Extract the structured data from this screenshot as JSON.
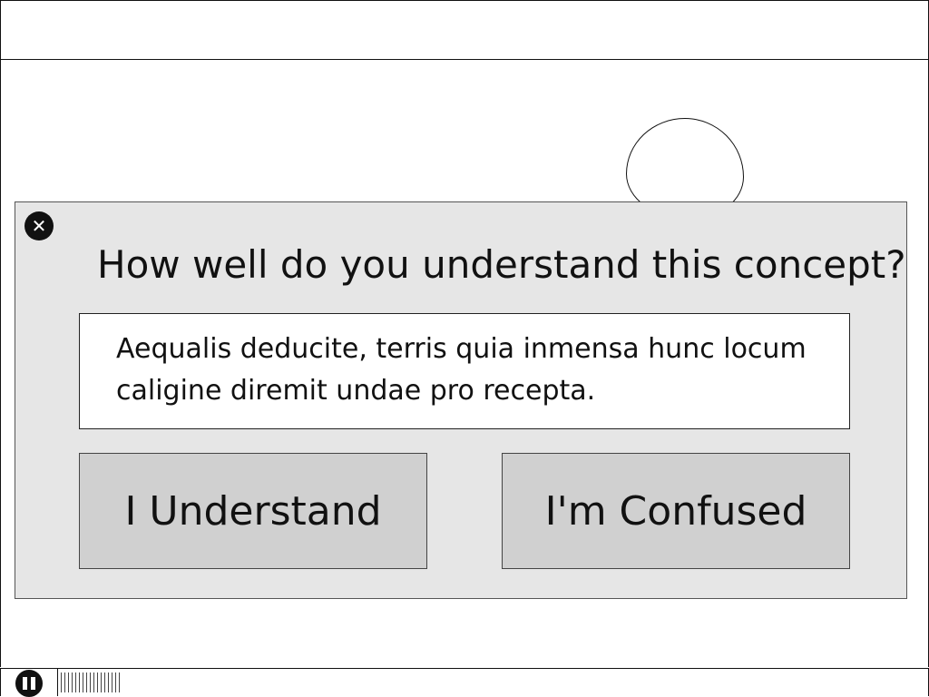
{
  "dialog": {
    "close_icon": "close-icon",
    "question": "How well do you understand this concept?",
    "body_text": "Aequalis deducite, terris quia inmensa hunc locum caligine diremit undae pro recepta.",
    "buttons": {
      "understand": "I Understand",
      "confused": "I'm Confused"
    }
  },
  "player": {
    "pause_icon": "pause-icon"
  },
  "colors": {
    "dialog_bg": "#e6e6e6",
    "button_bg": "#d0d0d0"
  }
}
